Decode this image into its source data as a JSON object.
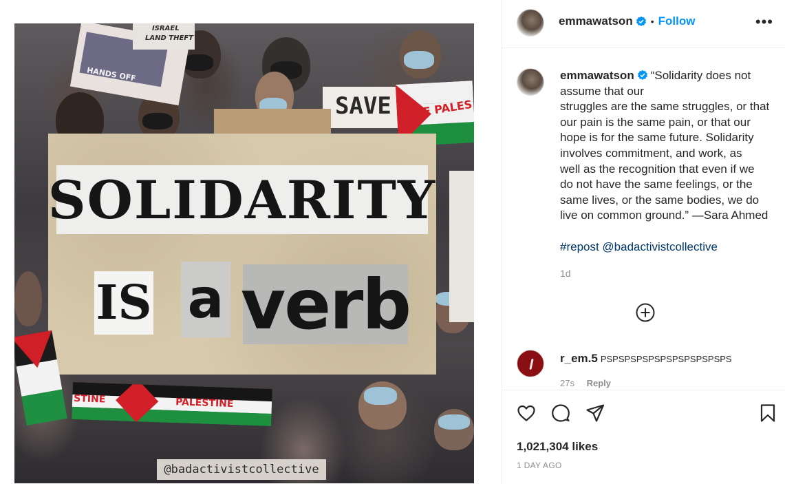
{
  "post_image": {
    "headline_word1": "SOLIDARITY",
    "headline_word2": "IS",
    "headline_word3": "a",
    "headline_word4": "verb",
    "watermark": "@badactivistcollective",
    "sign_save": "SAVE",
    "sign_free_palestine": "FREE PALES",
    "banner_left": "STINE",
    "banner_right": "PALESTINE",
    "sign_israel": "ISRAEL",
    "sign_land_theft": "LAND THEFT",
    "sign_hands_off": "HANDS OFF"
  },
  "header": {
    "username": "emmawatson",
    "separator": "•",
    "follow_label": "Follow",
    "more_icon": "more-horizontal-icon",
    "verified_icon": "verified-badge-icon"
  },
  "caption": {
    "username": "emmawatson",
    "lines": [
      "“Solidarity does not",
      "assume that our",
      "struggles are the same struggles, or that",
      "our pain is the same pain, or that our",
      "hope is for the same future. Solidarity",
      "involves commitment, and work, as",
      "well as the recognition that even if we",
      "do not have the same feelings, or the",
      "same lives, or the same bodies, we do",
      "live on common ground.” —Sara Ahmed"
    ],
    "hashtags": "#repost @badactivistcollective",
    "time": "1d",
    "load_more_icon": "plus-circle-icon"
  },
  "comments": [
    {
      "username": "r_em.5",
      "text": "PSPSPSPSPSPSPSPSPSPSPS",
      "time": "27s",
      "reply_label": "Reply"
    }
  ],
  "actions": {
    "like_icon": "heart-icon",
    "comment_icon": "comment-icon",
    "share_icon": "send-icon",
    "save_icon": "bookmark-icon",
    "likes": "1,021,304 likes",
    "date": "1 DAY AGO"
  },
  "colors": {
    "accent": "#0095f6",
    "hashtag": "#00376b",
    "muted": "#8e8e8e",
    "text": "#262626"
  }
}
